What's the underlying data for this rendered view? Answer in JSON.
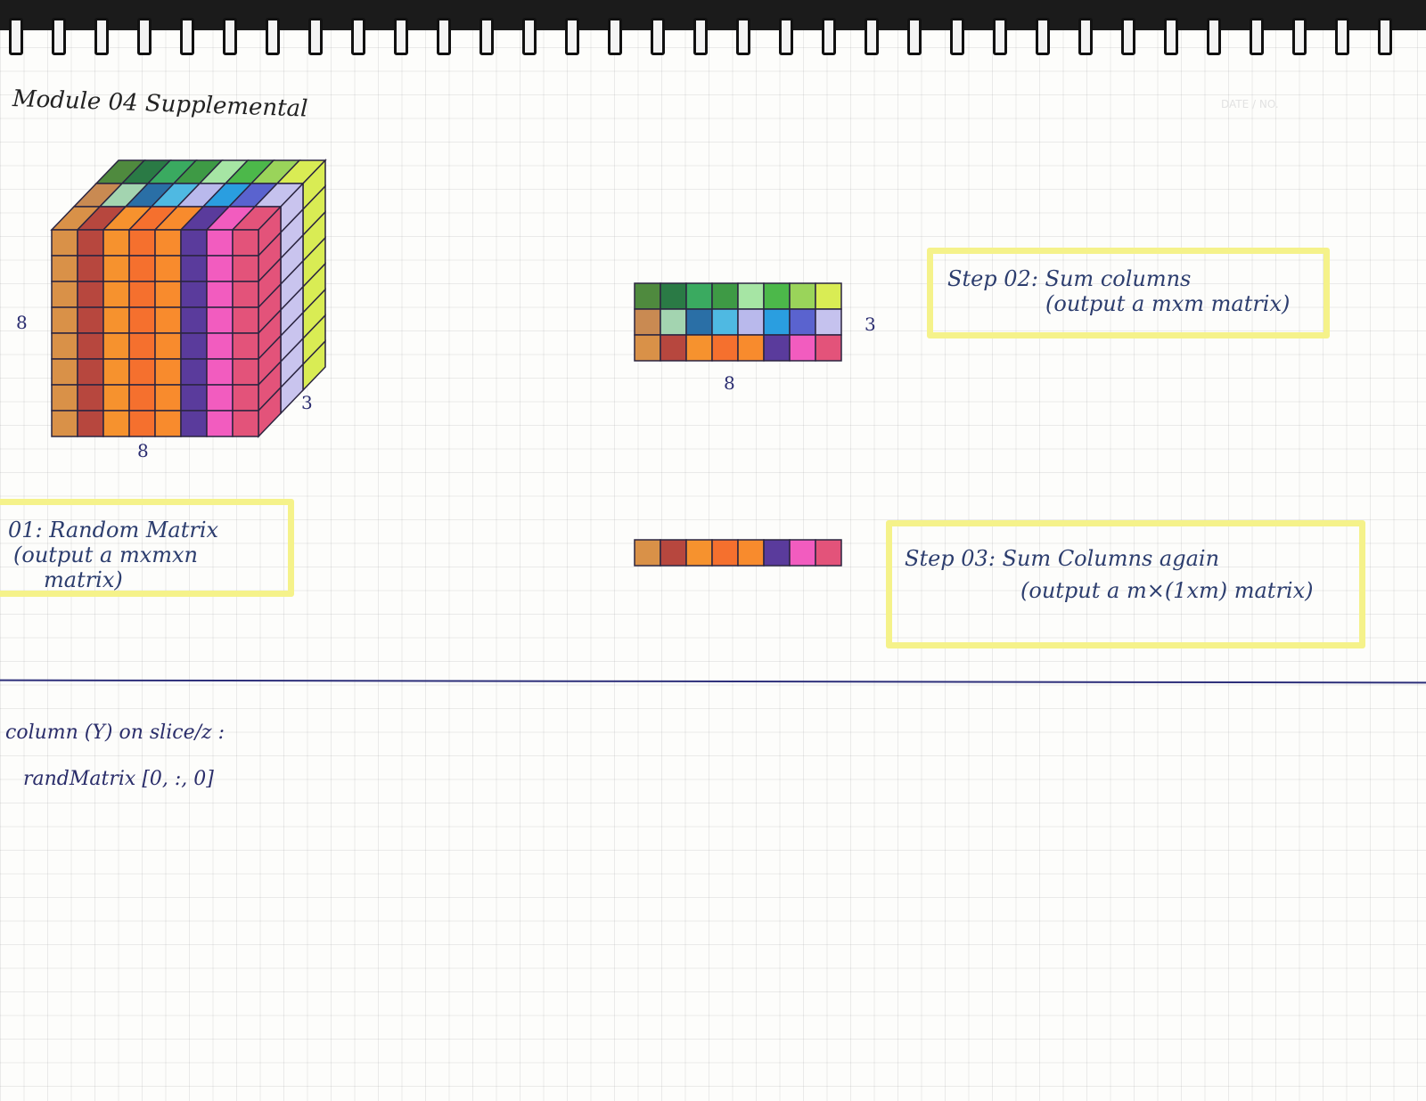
{
  "title": "Module 04 Supplemental",
  "header_right": "DATE / NO.",
  "cube": {
    "dims": {
      "height": "8",
      "width": "8",
      "depth": "3"
    },
    "front_colors": [
      "#d99148",
      "#b7473e",
      "#f6922e",
      "#f5702e",
      "#f88b2d",
      "#5a3b9c",
      "#f25cbf",
      "#e3537a"
    ],
    "middle_colors": [
      "#c98a52",
      "#a3d4b0",
      "#2a6fa6",
      "#4fb9e2",
      "#b9b9ec",
      "#2a9ee0",
      "#5a63cf",
      "#c5c2ee"
    ],
    "back_colors": [
      "#4f8a3e",
      "#2a7a45",
      "#3aaa60",
      "#3e9a45",
      "#a6e5a4",
      "#4cb84a",
      "#9ad45a",
      "#d9ec54"
    ],
    "side_colors": [
      "#c9c4ee",
      "#d9ec54"
    ]
  },
  "matrix2d": {
    "label_rows": "3",
    "label_cols": "8",
    "rows": [
      [
        "#4f8a3e",
        "#2a7a45",
        "#3aaa60",
        "#3e9a45",
        "#a6e5a4",
        "#4cb84a",
        "#9ad45a",
        "#d9ec54"
      ],
      [
        "#c98a52",
        "#a3d4b0",
        "#2a6fa6",
        "#4fb9e2",
        "#b9b9ec",
        "#2a9ee0",
        "#5a63cf",
        "#c5c2ee"
      ],
      [
        "#d99148",
        "#b7473e",
        "#f6922e",
        "#f5702e",
        "#f88b2d",
        "#5a3b9c",
        "#f25cbf",
        "#e3537a"
      ]
    ]
  },
  "vector": {
    "colors": [
      "#d99148",
      "#b7473e",
      "#f6922e",
      "#f5702e",
      "#f88b2d",
      "#5a3b9c",
      "#f25cbf",
      "#e3537a"
    ]
  },
  "step01": {
    "line1": "01: Random Matrix",
    "line2": "(output a  mxmxn",
    "line3": "matrix)"
  },
  "step02": {
    "line1": "Step 02: Sum  columns",
    "line2": "(output a  mxm matrix)"
  },
  "step03": {
    "line1": "Step 03: Sum  Columns  again",
    "line2": "(output  a  m×(1xm) matrix)"
  },
  "notes": {
    "line1": "column  (Y)  on  slice/z  :",
    "line2": "randMatrix [0, :, 0]"
  },
  "colors": {
    "highlight": "#f5f28a",
    "ink": "#2a2d6a"
  }
}
